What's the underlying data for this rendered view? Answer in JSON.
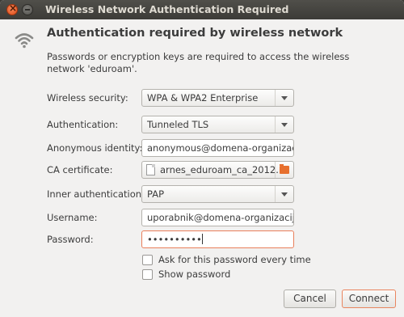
{
  "window": {
    "title": "Wireless Network Authentication Required"
  },
  "header": {
    "heading": "Authentication required by wireless network",
    "description": "Passwords or encryption keys are required to access the wireless network 'eduroam'."
  },
  "form": {
    "security": {
      "label": "Wireless security:",
      "value": "WPA & WPA2 Enterprise"
    },
    "authentication": {
      "label": "Authentication:",
      "value": "Tunneled TLS"
    },
    "anonymous_identity": {
      "label": "Anonymous identity:",
      "value": "anonymous@domena-organizacije"
    },
    "ca_certificate": {
      "label": "CA certificate:",
      "value": "arnes_eduroam_ca_2012...."
    },
    "inner_auth": {
      "label": "Inner authentication:",
      "value": "PAP"
    },
    "username": {
      "label": "Username:",
      "value": "uporabnik@domena-organizacije.s"
    },
    "password": {
      "label": "Password:",
      "value": "••••••••••"
    },
    "ask_every_time": {
      "label": "Ask for this password every time",
      "checked": false
    },
    "show_password": {
      "label": "Show password",
      "checked": false
    }
  },
  "buttons": {
    "cancel": "Cancel",
    "connect": "Connect"
  },
  "colors": {
    "accent": "#df4a16",
    "titlebar": "#3c3b37",
    "dialog_bg": "#f2f1f0",
    "focus_border": "#e97f5b"
  },
  "icons": {
    "wifi": "wifi-icon",
    "file": "file-icon",
    "folder": "folder-icon"
  }
}
